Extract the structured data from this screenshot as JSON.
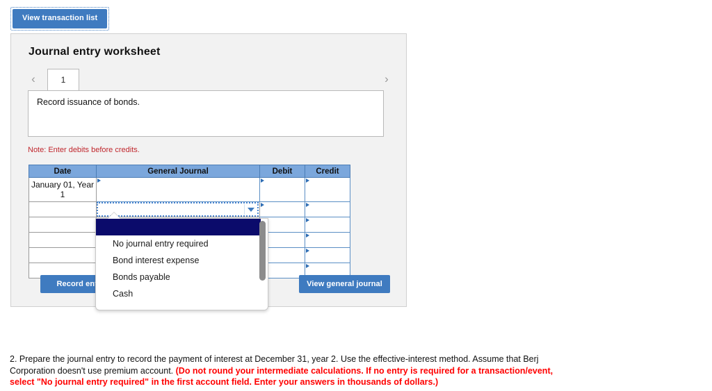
{
  "top_button": {
    "label": "View transaction list",
    "name": "view-transaction-list"
  },
  "panel": {
    "title": "Journal entry worksheet",
    "tabs": [
      {
        "label": "1",
        "active": true
      }
    ],
    "nav": {
      "prev": "‹",
      "next": "›"
    },
    "description": "Record issuance of bonds.",
    "note": "Note: Enter debits before credits."
  },
  "table": {
    "headers": [
      "Date",
      "General Journal",
      "Debit",
      "Credit"
    ],
    "rows": [
      {
        "date": "January 01, Year 1",
        "general_journal": "",
        "debit": "",
        "credit": ""
      },
      {
        "date": "",
        "general_journal": "",
        "debit": "",
        "credit": ""
      },
      {
        "date": "",
        "general_journal": "",
        "debit": "",
        "credit": ""
      },
      {
        "date": "",
        "general_journal": "",
        "debit": "",
        "credit": ""
      },
      {
        "date": "",
        "general_journal": "",
        "debit": "",
        "credit": ""
      },
      {
        "date": "",
        "general_journal": "",
        "debit": "",
        "credit": ""
      }
    ]
  },
  "dropdown": {
    "open": true,
    "selected_value": "",
    "options": [
      "",
      "No journal entry required",
      "Bond interest expense",
      "Bonds payable",
      "Cash"
    ]
  },
  "buttons": {
    "record_entry": "Record entry",
    "view_general_journal": "View general journal"
  },
  "question": {
    "part1": "2. Prepare the journal entry to record the payment of interest at December 31, year 2. Use the effective-interest method. Assume that Berj Corporation doesn't use premium account. ",
    "part2": "(Do not round your intermediate calculations. If no entry is required for a transaction/event, select \"No journal entry required\" in the first account field. Enter your answers in thousands of dollars.)"
  },
  "colors": {
    "button_blue": "#3f7bc0",
    "header_blue": "#7ba7dc",
    "panel_grey": "#f2f2f2",
    "note_red": "#c0272d",
    "question_red": "#ff0000",
    "dropdown_selected": "#0b0b6b"
  }
}
